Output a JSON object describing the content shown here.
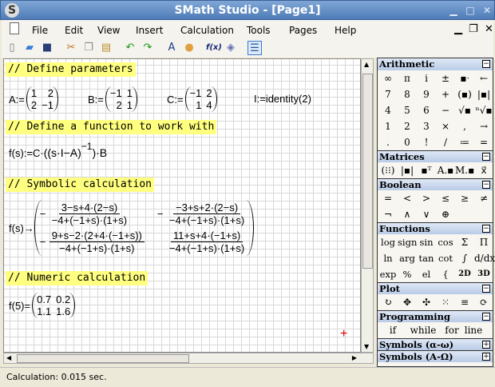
{
  "window": {
    "title": "SMath Studio - [Page1]",
    "logo": "S",
    "minimize": "▁",
    "maximize": "□",
    "close": "✕"
  },
  "menu": {
    "items": [
      "File",
      "Edit",
      "View",
      "Insert",
      "Calculation",
      "Tools",
      "Pages",
      "Help"
    ],
    "mdi_minimize": "▁",
    "mdi_restore": "❐",
    "mdi_close": "✕"
  },
  "toolbar": {
    "icons": [
      {
        "name": "new-document-icon",
        "glyph": "▯",
        "color": "#777"
      },
      {
        "name": "open-folder-icon",
        "glyph": "▰",
        "color": "#3a7bd5"
      },
      {
        "name": "save-icon",
        "glyph": "■",
        "color": "#2a3f7a"
      },
      {
        "name": "cut-icon",
        "glyph": "✂",
        "color": "#c07020"
      },
      {
        "name": "copy-icon",
        "glyph": "❐",
        "color": "#888"
      },
      {
        "name": "paste-icon",
        "glyph": "▤",
        "color": "#c09030"
      },
      {
        "name": "undo-icon",
        "glyph": "↶",
        "color": "#1a9a1a"
      },
      {
        "name": "redo-icon",
        "glyph": "↷",
        "color": "#1a9a1a"
      },
      {
        "name": "text-style-icon",
        "glyph": "A",
        "color": "#1a3c8a"
      },
      {
        "name": "color-palette-icon",
        "glyph": "●",
        "color": "#e0a040"
      },
      {
        "name": "insert-function-icon",
        "glyph": "f(x)",
        "color": "#1a2a7a"
      },
      {
        "name": "help-book-icon",
        "glyph": "◈",
        "color": "#6070b0"
      },
      {
        "name": "toggle-sidebar-icon",
        "glyph": "☰",
        "color": "#1a5aa0"
      }
    ]
  },
  "worksheet": {
    "comments": [
      "// Define parameters",
      "// Define a function to work with",
      "// Symbolic calculation",
      "// Numeric calculation"
    ],
    "A": {
      "lhs": "A:=",
      "m": [
        "1",
        "2",
        "2",
        "−1"
      ]
    },
    "B": {
      "lhs": "B:=",
      "m": [
        "−1",
        "1",
        "2",
        "1"
      ]
    },
    "C": {
      "lhs": "C:=",
      "m": [
        "−1",
        "2",
        "1",
        "4"
      ]
    },
    "I": {
      "expr": "I:=identity(2)"
    },
    "f_def": {
      "lhs": "f(s):=C·",
      "inner": "((s·I−A)",
      "exp": "−1",
      "rhs": ")·B"
    },
    "symbolic": {
      "lhs": "f(s)→",
      "cells": [
        {
          "sign": "−",
          "num": "3−s+4·(2−s)",
          "den": "−4+(−1+s)·(1+s)"
        },
        {
          "sign": "−",
          "num": "−3+s+2·(2−s)",
          "den": "−4+(−1+s)·(1+s)"
        },
        {
          "sign": "−",
          "num": "9+s−2·(2+4·(−1+s))",
          "den": "−4+(−1+s)·(1+s)"
        },
        {
          "sign": "",
          "num": "11+s+4·(−1+s)",
          "den": "−4+(−1+s)·(1+s)"
        }
      ]
    },
    "numeric": {
      "lhs": "f(5)=",
      "m": [
        "0.7",
        "0.2",
        "1.1",
        "1.6"
      ]
    },
    "cursor": "+"
  },
  "panel": {
    "sections": [
      {
        "title": "Arithmetic",
        "toggle": "−",
        "buttons": [
          "∞",
          "π",
          "i",
          "±",
          "▪ᐧ",
          "←",
          "7",
          "8",
          "9",
          "+",
          "(▪)",
          "|▪|",
          "4",
          "5",
          "6",
          "−",
          "√▪",
          "ⁿ√▪",
          "1",
          "2",
          "3",
          "×",
          ",",
          "→",
          ".",
          "0",
          "!",
          "/",
          "≔",
          "="
        ]
      },
      {
        "title": "Matrices",
        "toggle": "−",
        "buttons": [
          "(⁝⁝)",
          "|▪|",
          "▪ᵀ",
          "A.▪",
          "M.▪",
          "x⃗"
        ]
      },
      {
        "title": "Boolean",
        "toggle": "−",
        "buttons": [
          "=",
          "<",
          ">",
          "≤",
          "≥",
          "≠",
          "¬",
          "∧",
          "∨",
          "⊕"
        ]
      },
      {
        "title": "Functions",
        "toggle": "−",
        "buttons": [
          "log",
          "sign",
          "sin",
          "cos",
          "Σ",
          "Π",
          "ln",
          "arg",
          "tan",
          "cot",
          "∫",
          "d/dx",
          "exp",
          "%",
          "el",
          "{",
          "2D",
          "3D"
        ]
      },
      {
        "title": "Plot",
        "toggle": "−",
        "buttons": [
          "↻",
          "✥",
          "✣",
          "⁙",
          "≡",
          "⟳"
        ]
      },
      {
        "title": "Programming",
        "toggle": "−",
        "buttons": [
          "if",
          "while",
          "for",
          "line"
        ]
      },
      {
        "title": "Symbols (α-ω)",
        "toggle": "+",
        "buttons": []
      },
      {
        "title": "Symbols (A-Ω)",
        "toggle": "+",
        "buttons": []
      }
    ]
  },
  "status": {
    "text": "Calculation: 0.015 sec."
  }
}
